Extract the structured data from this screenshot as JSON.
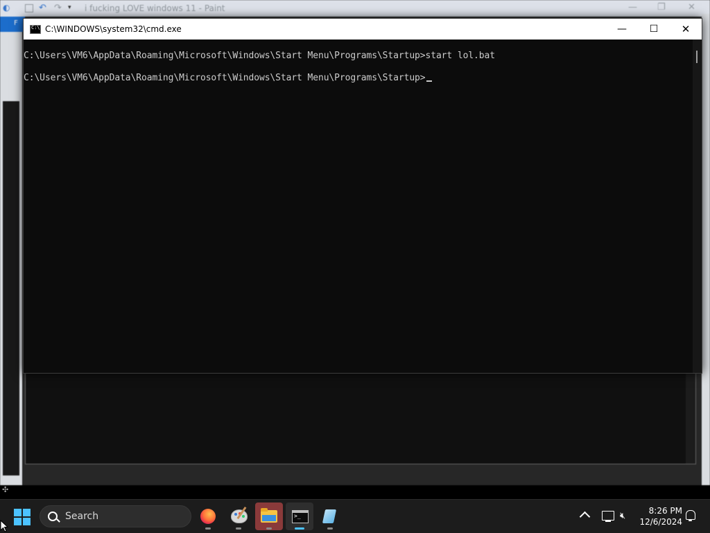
{
  "background_app": {
    "title": "i fucking LOVE windows 11 - Paint",
    "ribbon_tab": "F"
  },
  "cmd": {
    "title": "C:\\WINDOWS\\system32\\cmd.exe",
    "minimize": "—",
    "maximize": "☐",
    "close": "✕",
    "lines": [
      "C:\\Users\\VM6\\AppData\\Roaming\\Microsoft\\Windows\\Start Menu\\Programs\\Startup>start lol.bat",
      "C:\\Users\\VM6\\AppData\\Roaming\\Microsoft\\Windows\\Start Menu\\Programs\\Startup>"
    ]
  },
  "taskbar": {
    "search_label": "Search",
    "apps": [
      {
        "icon": "firefox-icon"
      },
      {
        "icon": "paint-icon"
      },
      {
        "icon": "file-explorer-icon"
      },
      {
        "icon": "terminal-icon",
        "active": true
      },
      {
        "icon": "notepad-icon"
      }
    ],
    "time": "8:26 PM",
    "date": "12/6/2024"
  },
  "colors": {
    "accent": "#4cc2ff",
    "console_bg": "#0c0c0c",
    "console_text": "#cccccc",
    "taskbar_bg": "#1c1c1c"
  }
}
